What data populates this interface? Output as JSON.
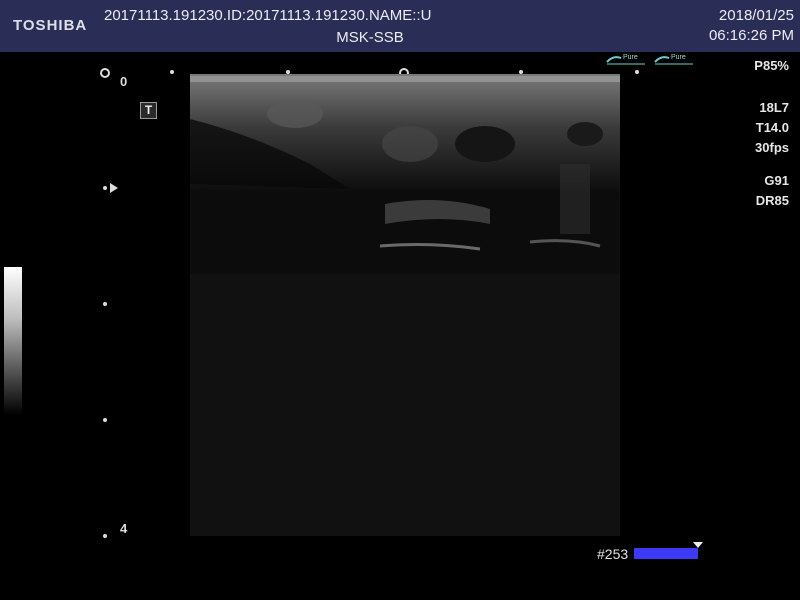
{
  "header": {
    "brand": "TOSHIBA",
    "patient_line": "20171113.191230.ID:20171113.191230.NAME::U",
    "preset": "MSK-SSB",
    "date": "2018/01/25",
    "time": "06:16:26 PM"
  },
  "depth_scale": {
    "top": "0",
    "bottom": "4"
  },
  "params": {
    "power": "P85%",
    "probe": "18L7",
    "tissue": "T14.0",
    "frame_rate": "30fps",
    "gain": "G91",
    "dynamic_range": "DR85"
  },
  "mode_icons": {
    "first": "Pure",
    "second": "Pure"
  },
  "frame": {
    "label": "#253",
    "bar_color": "#3b3bf5"
  },
  "tgc_icon": "T",
  "icons": {
    "t-icon": "T-box",
    "focus-marker": "triangle-right"
  }
}
